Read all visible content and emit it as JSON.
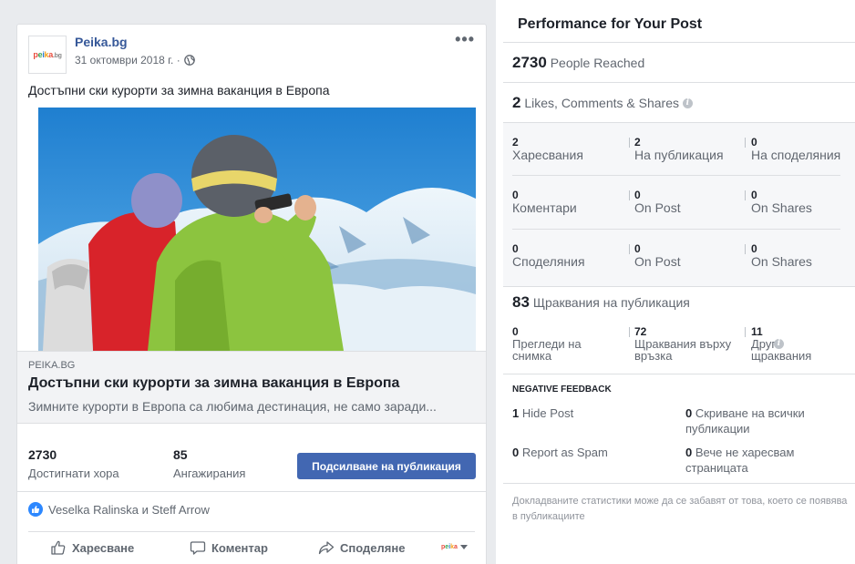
{
  "post": {
    "page_name": "Peika.bg",
    "logo_text": "peika.bg",
    "date": "31 октомври 2018 г. ·",
    "more_label": "•••",
    "text": "Достъпни ски курорти за зимна ваканция в Европа",
    "link": {
      "domain": "PEIKA.BG",
      "title": "Достъпни ски курорти за зимна ваканция в Европа",
      "description": "Зимните курорти в Европа са любима дестинация, не само заради..."
    },
    "stats": {
      "reached_value": "2730",
      "reached_label": "Достигнати хора",
      "engagement_value": "85",
      "engagement_label": "Ангажирания"
    },
    "boost_label": "Подсилване на публикация",
    "reactions_text": "Veselka Ralinska и Steff Arrow",
    "actions": {
      "like": "Харесване",
      "comment": "Коментар",
      "share": "Споделяне"
    }
  },
  "performance": {
    "title": "Performance for Your Post",
    "reached": {
      "value": "2730",
      "label": "People Reached"
    },
    "engagement": {
      "value": "2",
      "label": "Likes, Comments & Shares"
    },
    "grid": [
      [
        {
          "value": "2",
          "label": "Харесвания"
        },
        {
          "value": "2",
          "label": "На публикация"
        },
        {
          "value": "0",
          "label": "На споделяния"
        }
      ],
      [
        {
          "value": "0",
          "label": "Коментари"
        },
        {
          "value": "0",
          "label": "On Post"
        },
        {
          "value": "0",
          "label": "On Shares"
        }
      ],
      [
        {
          "value": "0",
          "label": "Споделяния"
        },
        {
          "value": "0",
          "label": "On Post"
        },
        {
          "value": "0",
          "label": "On Shares"
        }
      ]
    ],
    "clicks": {
      "value": "83",
      "label": "Щраквания на публикация",
      "items": [
        {
          "value": "0",
          "label": "Прегледи на снимка"
        },
        {
          "value": "72",
          "label": "Щраквания върху връзка"
        },
        {
          "value": "11",
          "label": "Други щраквания"
        }
      ]
    },
    "negative": {
      "title": "NEGATIVE FEEDBACK",
      "hide_post_value": "1",
      "hide_post_label": "Hide Post",
      "hide_all_value": "0",
      "hide_all_label": "Скриване на всички публикации",
      "spam_value": "0",
      "spam_label": "Report as Spam",
      "unlike_value": "0",
      "unlike_label": "Вече не харесвам страницата"
    },
    "footnote": "Докладваните статистики може да се забавят от това, което се появява в публикациите"
  },
  "icons": [
    "globe-icon",
    "info-icon",
    "like-reaction-icon",
    "thumbs-up-icon",
    "comment-icon",
    "share-icon",
    "chevron-down-icon"
  ],
  "colors": {
    "link_blue": "#365899",
    "button_blue": "#4267b2",
    "like_blue": "#2d88ff"
  }
}
